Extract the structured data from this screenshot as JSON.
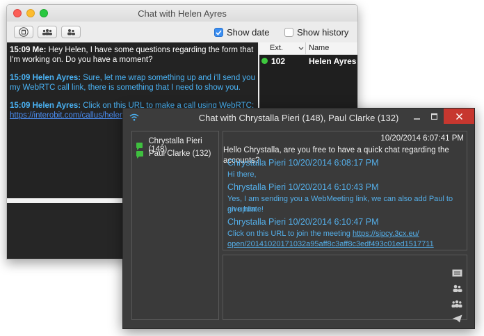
{
  "mac_window": {
    "title": "Chat with Helen Ayres",
    "toolbar": {
      "show_date_label": "Show date",
      "show_date_checked": true,
      "show_history_label": "Show history",
      "show_history_checked": false
    },
    "messages": [
      {
        "time": "15:09",
        "sender": "Me:",
        "text_line1": "Hey Helen, I have some questions regarding the form that",
        "text_line2": "I'm working on. Do you have a moment?"
      },
      {
        "time": "15:09",
        "sender": "Helen Ayres:",
        "text_line1": "Sure, let me wrap something up and i'll send you",
        "text_line2": "my WebRTC call link, there is something that I need to show you."
      },
      {
        "time": "15:09",
        "sender": "Helen Ayres:",
        "text_line1": "Click on this URL to make a call using WebRTC:",
        "link": "https://interobit.com/callus/helen"
      }
    ],
    "extension_list": {
      "col_ext": "Ext.",
      "col_name": "Name",
      "rows": [
        {
          "ext": "102",
          "name": "Helen Ayres",
          "status_color": "#3ec93e"
        }
      ]
    }
  },
  "win_window": {
    "title": "Chat with Chrystalla Pieri (148), Paul Clarke (132)",
    "participants": [
      {
        "name": "Chrystalla Pieri (148)"
      },
      {
        "name": "Paul Clarke (132)"
      }
    ],
    "conversation": {
      "timestamp": "10/20/2014 6:07:41 PM",
      "first_message": "Hello Chrystalla, are you free to have a quick chat regarding the accounts?",
      "entries": [
        {
          "header": "Chrystalla Pieri 10/20/2014 6:08:17 PM",
          "lines": [
            "Hi there,"
          ]
        },
        {
          "header": "Chrystalla Pieri 10/20/2014 6:10:43 PM",
          "lines": [
            "Yes, I am sending you a WebMeeting link, we can also add Paul to give him",
            "an update!"
          ]
        },
        {
          "header": "Chrystalla Pieri 10/20/2014 6:10:47 PM",
          "line_prefix": "Click on this URL to join the meeting ",
          "link_part1": "https://sipcy.3cx.eu/",
          "link_part2": "open/20141020171032a95aff8c3aff8c3edf493c01ed1517711"
        }
      ]
    }
  },
  "colors": {
    "accent_blue": "#54aee8",
    "mac_link": "#4a8cf0",
    "close_red": "#c7372f",
    "online_green": "#3fbf3f"
  }
}
